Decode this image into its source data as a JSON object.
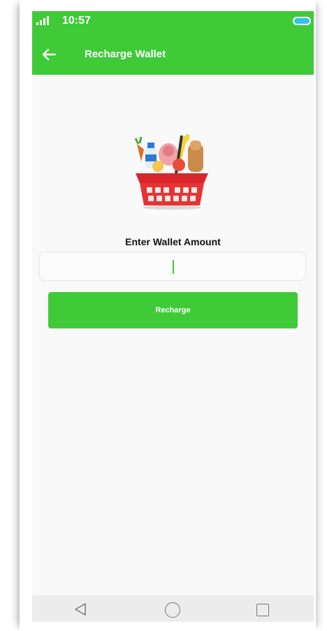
{
  "status_bar": {
    "time": "10:57"
  },
  "app_bar": {
    "title": "Recharge Wallet"
  },
  "form": {
    "amount_label": "Enter Wallet Amount",
    "amount_value": ""
  },
  "actions": {
    "recharge_label": "Recharge"
  },
  "colors": {
    "brand": "#3fca38",
    "battery": "#2ec4e6"
  },
  "icons": {
    "back": "arrow-left-icon",
    "basket": "grocery-basket-icon",
    "nav_back": "triangle-back-icon",
    "nav_home": "circle-home-icon",
    "nav_recent": "square-recent-icon"
  }
}
